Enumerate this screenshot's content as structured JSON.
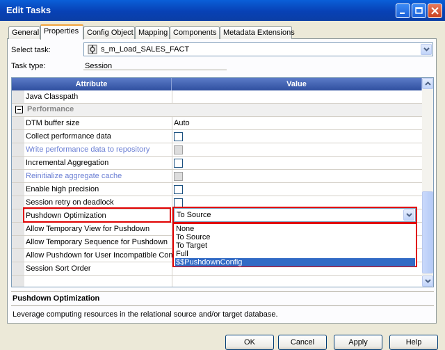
{
  "window": {
    "title": "Edit Tasks"
  },
  "tabs": [
    {
      "label": "General"
    },
    {
      "label": "Properties",
      "active": true
    },
    {
      "label": "Config Object"
    },
    {
      "label": "Mapping"
    },
    {
      "label": "Components"
    },
    {
      "label": "Metadata Extensions"
    }
  ],
  "select_task": {
    "label": "Select task:",
    "value": "s_m_Load_SALES_FACT"
  },
  "task_type": {
    "label": "Task type:",
    "value": "Session"
  },
  "grid": {
    "headers": {
      "attribute": "Attribute",
      "value": "Value"
    },
    "rows": [
      {
        "attr": "Java Classpath",
        "type": "text",
        "value": ""
      },
      {
        "attr": "Performance",
        "type": "section"
      },
      {
        "attr": "DTM buffer size",
        "type": "text",
        "value": "Auto"
      },
      {
        "attr": "Collect performance data",
        "type": "checkbox",
        "checked": false
      },
      {
        "attr": "Write performance data to repository",
        "type": "checkbox",
        "disabled": true
      },
      {
        "attr": "Incremental Aggregation",
        "type": "checkbox",
        "checked": false
      },
      {
        "attr": "Reinitialize aggregate cache",
        "type": "checkbox",
        "disabled": true
      },
      {
        "attr": "Enable high precision",
        "type": "checkbox",
        "checked": false
      },
      {
        "attr": "Session retry on deadlock",
        "type": "checkbox",
        "checked": false
      },
      {
        "attr": "Pushdown Optimization",
        "type": "combo",
        "value": "To Source"
      },
      {
        "attr": "Allow Temporary View for Pushdown",
        "type": "text",
        "value": ""
      },
      {
        "attr": "Allow Temporary Sequence for Pushdown",
        "type": "text",
        "value": ""
      },
      {
        "attr": "Allow Pushdown for User Incompatible Con...",
        "type": "text",
        "value": ""
      },
      {
        "attr": "Session Sort Order",
        "type": "text",
        "value": ""
      }
    ]
  },
  "pushdown_dropdown": {
    "options": [
      "None",
      "To Source",
      "To Target",
      "Full",
      "$$PushdownConfig"
    ],
    "highlighted": 4
  },
  "description": {
    "title": "Pushdown Optimization",
    "text": "Leverage computing resources in the relational source and/or target database."
  },
  "buttons": {
    "ok": "OK",
    "cancel": "Cancel",
    "apply": "Apply",
    "help": "Help"
  },
  "colors": {
    "titlebar": "#0a5fd8",
    "highlight_border": "#e00000",
    "selection": "#316ac5"
  }
}
